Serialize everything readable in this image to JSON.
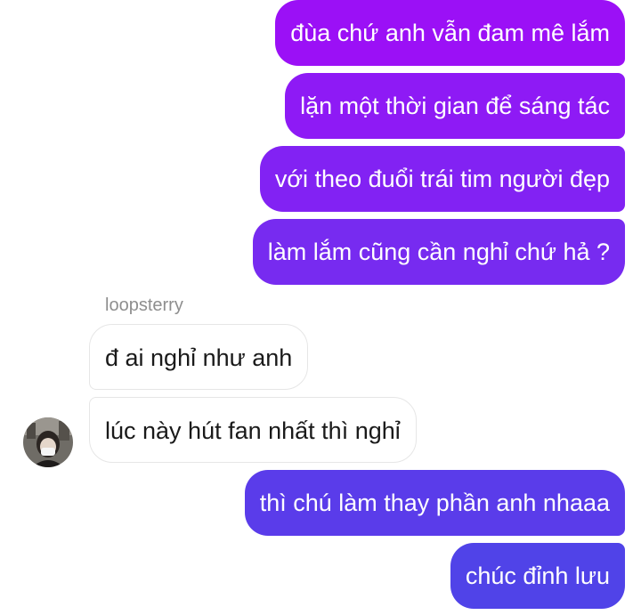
{
  "thread": {
    "messages": [
      {
        "from": "me",
        "text": "đùa chứ anh vẫn đam mê lắm",
        "color": "#9b10f6"
      },
      {
        "from": "me",
        "text": "lặn một thời gian để sáng tác",
        "color": "#8e1af5"
      },
      {
        "from": "me",
        "text": "với theo đuổi trái tim người đẹp",
        "color": "#8222f3"
      },
      {
        "from": "me",
        "text": "làm lắm cũng cần nghỉ chứ hả ?",
        "color": "#772bf0"
      },
      {
        "from": "them",
        "text": "đ ai nghỉ như anh"
      },
      {
        "from": "them",
        "text": "lúc này hút fan nhất thì nghỉ"
      },
      {
        "from": "me",
        "text": "thì chú làm thay phần anh nhaaa",
        "color": "#5a3cea"
      },
      {
        "from": "me",
        "text": "chúc đỉnh lưu",
        "color": "#5043e8"
      }
    ],
    "sender_name": "loopsterry",
    "avatar_icon": "profile-photo-icon"
  }
}
